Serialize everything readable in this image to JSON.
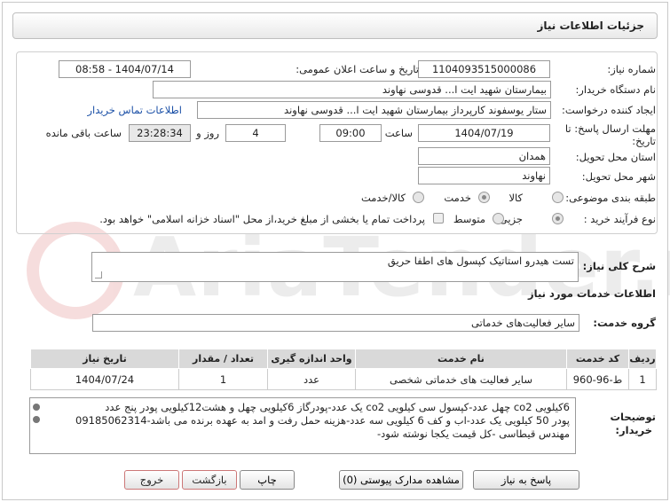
{
  "header": {
    "title": "جزئیات اطلاعات نیاز"
  },
  "watermark": {
    "text": "AriaTender.net"
  },
  "fields": {
    "need_number_label": "شماره نیاز:",
    "need_number": "1104093515000086",
    "announce_label": "تاریخ و ساعت اعلان عمومی:",
    "announce_value": "1404/07/14 - 08:58",
    "buyer_org_label": "نام دستگاه خریدار:",
    "buyer_org": "بیمارستان شهید ایت ا... قدوسی نهاوند",
    "creator_label": "ایجاد کننده درخواست:",
    "creator": "ستار یوسفوند کارپرداز بیمارستان شهید ایت ا... قدوسی نهاوند",
    "contact_link": "اطلاعات تماس خریدار",
    "deadline_label": "مهلت ارسال پاسخ: تا تاریخ:",
    "deadline_date": "1404/07/19",
    "time_label": "ساعت",
    "deadline_time": "09:00",
    "days": "4",
    "days_label": "روز و",
    "remaining": "23:28:34",
    "remaining_label": "ساعت باقی مانده",
    "province_label": "استان محل تحویل:",
    "province": "همدان",
    "city_label": "شهر محل تحویل:",
    "city": "نهاوند",
    "category_label": "طبقه بندی موضوعی:",
    "category_options": [
      "کالا",
      "خدمت",
      "کالا/خدمت"
    ],
    "category_selected": "خدمت",
    "process_label": "نوع فرآیند خرید :",
    "process_options": [
      "جزیی",
      "متوسط"
    ],
    "process_selected": "جزیی",
    "payment_note": "پرداخت تمام یا بخشی از مبلغ خرید،از محل \"اسناد خزانه اسلامی\" خواهد بود."
  },
  "summary": {
    "label": "شرح کلی نیاز:",
    "value": "تست هیدرو استاتیک کپسول های اطفا حریق"
  },
  "services": {
    "section_title": "اطلاعات خدمات مورد نیاز",
    "group_label": "گروه خدمت:",
    "group_value": "سایر فعالیت‌های خدماتی",
    "columns": [
      "ردیف",
      "کد خدمت",
      "نام خدمت",
      "واحد اندازه گیری",
      "تعداد / مقدار",
      "تاریخ نیاز"
    ],
    "rows": [
      [
        "1",
        "ط-96-960",
        "سایر فعالیت های خدماتی شخصی",
        "عدد",
        "1",
        "1404/07/24"
      ]
    ]
  },
  "buyer_notes": {
    "label_line1": "توضیحات",
    "label_line2": "خریدار:",
    "line1": "6کیلویی co2 چهل عدد-کپسول سی کیلویی co2 یک عدد-پودرگاز 6کیلویی چهل و هشت12کیلویی پودر  پنج عدد",
    "line2": "پودر  50 کیلویی یک عدد-اب و کف 6 کیلویی سه عدد-هزینه حمل رفت و امد به عهده برنده می باشد-09185062314",
    "line3": "مهندس قیطاسی  -کل قیمت یکجا نوشته شود-"
  },
  "buttons": {
    "reply": "پاسخ به نیاز",
    "attachments": "مشاهده مدارک پیوستی (0)",
    "print": "چاپ",
    "back": "بازگشت",
    "exit": "خروج"
  }
}
